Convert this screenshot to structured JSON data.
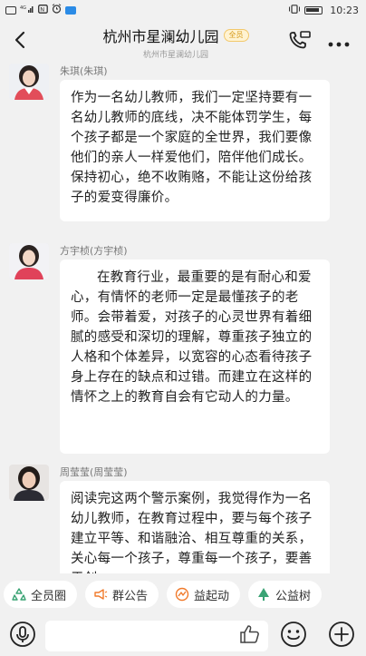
{
  "status_bar": {
    "time": "10:23",
    "network": "4G",
    "icons": [
      "hd-icon",
      "signal-icon",
      "nfc-icon",
      "alarm-icon",
      "app-icon",
      "vibrate-icon",
      "battery-icon"
    ]
  },
  "header": {
    "title": "杭州市星澜幼儿园",
    "badge": "全员",
    "subtitle": "杭州市星澜幼儿园",
    "icons": [
      "back-icon",
      "phone-call-icon",
      "more-icon"
    ]
  },
  "messages": [
    {
      "sender": "朱琪(朱琪)",
      "text": "作为一名幼儿教师，我们一定坚持要有一名幼儿教师的底线，决不能体罚学生，每个孩子都是一个家庭的全世界，我们要像他们的亲人一样爱他们，陪伴他们成长。保持初心，绝不收贿赂，不能让这份给孩子的爱变得廉价。"
    },
    {
      "sender": "方宇桢(方宇桢)",
      "text": "在教育行业，最重要的是有耐心和爱心，有情怀的老师一定是最懂孩子的老师。会带着爱，对孩子的心灵世界有着细腻的感受和深切的理解，尊重孩子独立的人格和个体差异，以宽容的心态看待孩子身上存在的缺点和过错。而建立在这样的情怀之上的教育自会有它动人的力量。"
    },
    {
      "sender": "周莹莹(周莹莹)",
      "text": "阅读完这两个警示案例，我觉得作为一名幼儿教师，在教育过程中，要与每个孩子建立平等、和谐融洽、相互尊重的关系，关心每一个孩子，尊重每一个孩子，要善于创"
    }
  ],
  "quick_actions": [
    {
      "label": "全员圈",
      "icon": "recycle-icon",
      "color": "#3aa374"
    },
    {
      "label": "群公告",
      "icon": "megaphone-icon",
      "color": "#f07a2b"
    },
    {
      "label": "益起动",
      "icon": "activity-icon",
      "color": "#f07a2b"
    },
    {
      "label": "公益树",
      "icon": "tree-icon",
      "color": "#3aa374"
    }
  ],
  "input_bar": {
    "placeholder": "",
    "icons": [
      "voice-icon",
      "thumbs-up-icon",
      "emoji-icon",
      "plus-icon"
    ]
  },
  "colors": {
    "background": "#f1f1f1",
    "bubble": "#ffffff",
    "badge_text": "#d69a1a",
    "green": "#3aa374",
    "orange": "#f07a2b"
  }
}
